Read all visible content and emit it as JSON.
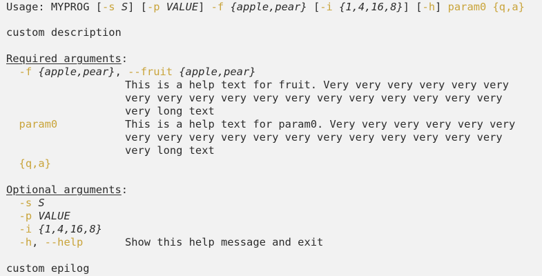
{
  "usage": {
    "prefix": "Usage: MYPROG ",
    "s_flag": "-s",
    "s_meta": "S",
    "p_flag": "-p",
    "p_meta": "VALUE",
    "f_flag": "-f",
    "f_meta": "{apple,pear}",
    "i_flag": "-i",
    "i_meta": "{1,4,16,8}",
    "h_flag": "-h",
    "param0": "param0",
    "qa": "{q,a}"
  },
  "description": "custom description",
  "required": {
    "header": "Required arguments",
    "fruit": {
      "short": "-f",
      "meta": "{apple,pear}",
      "long": "--fruit",
      "help": [
        "This is a help text for fruit. Very very very very very very",
        "very very very very very very very very very very very very",
        "very long text"
      ]
    },
    "param0": {
      "name": "param0",
      "help": [
        "This is a help text for param0. Very very very very very very",
        "very very very very very very very very very very very very",
        "very long text"
      ]
    },
    "qa": "{q,a}"
  },
  "optional": {
    "header": "Optional arguments",
    "s": {
      "flag": "-s",
      "meta": "S"
    },
    "p": {
      "flag": "-p",
      "meta": "VALUE"
    },
    "i": {
      "flag": "-i",
      "meta": "{1,4,16,8}"
    },
    "h": {
      "short": "-h",
      "long": "--help",
      "help": "Show this help message and exit"
    }
  },
  "epilog": "custom epilog",
  "colors": {
    "background": "#f2f2f2",
    "text": "#2b2b2b",
    "option": "#c9a43a"
  }
}
